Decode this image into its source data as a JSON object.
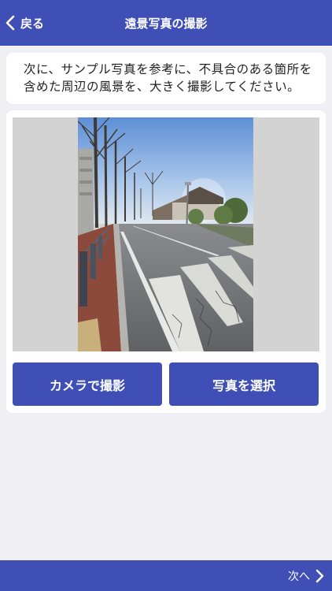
{
  "header": {
    "back_label": "戻る",
    "title": "遠景写真の撮影",
    "back_icon": "chevron-left-icon"
  },
  "instruction": {
    "line1": "次に、サンプル写真を参考に、不具合のある箇所を",
    "line2": "含めた周辺の風景を、大きく撮影してください。"
  },
  "buttons": {
    "camera_label": "カメラで撮影",
    "select_label": "写真を選択"
  },
  "footer": {
    "next_label": "次へ",
    "next_icon": "chevron-right-icon"
  },
  "colors": {
    "primary": "#3f4fb5",
    "background": "#efeff4"
  }
}
